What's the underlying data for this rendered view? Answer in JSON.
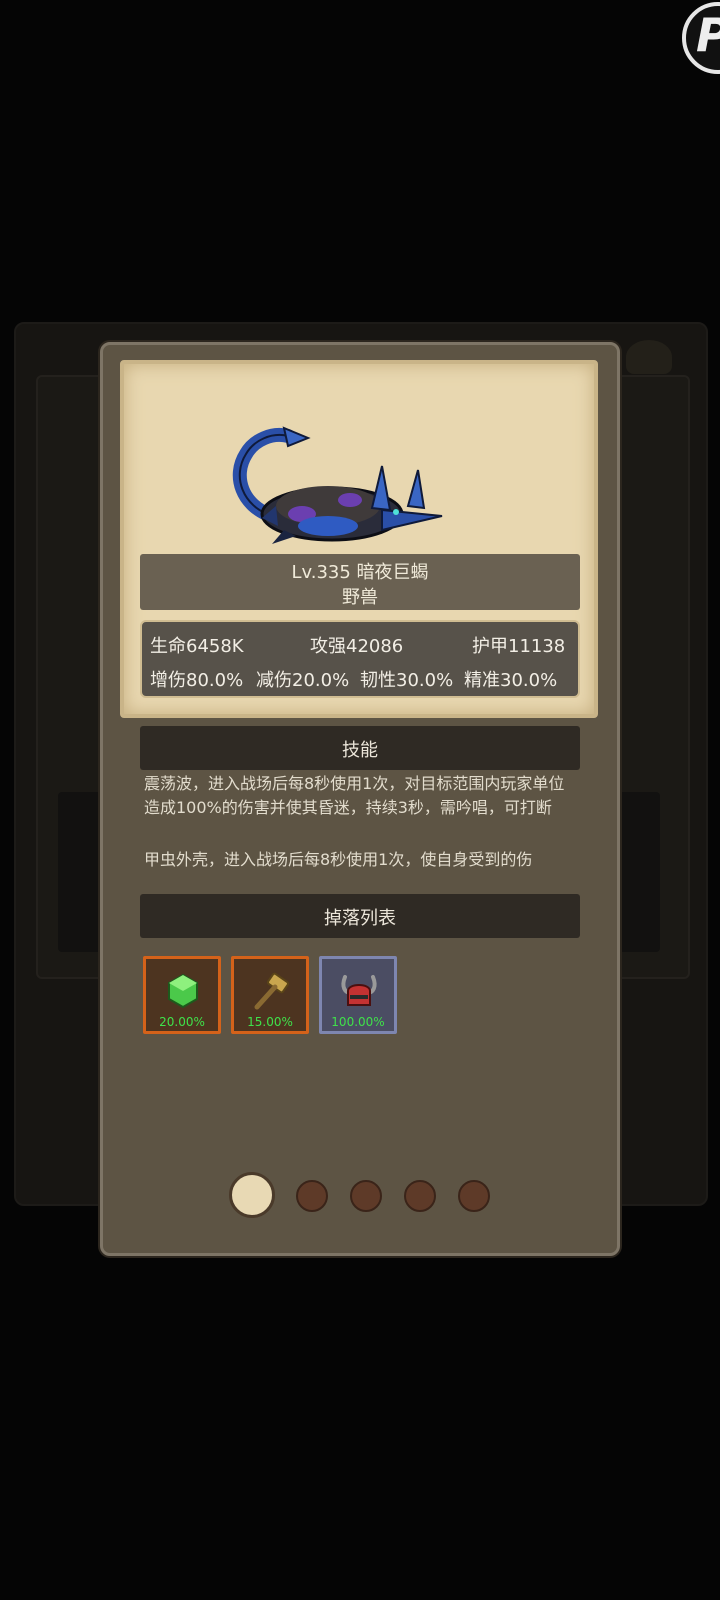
{
  "monster": {
    "level_name": "Lv.335 暗夜巨蝎",
    "type": "野兽",
    "icon": "scorpion-monster-icon"
  },
  "stats": {
    "hp": "生命6458K",
    "attack": "攻强42086",
    "armor": "护甲11138",
    "dmg_up": "增伤80.0%",
    "dmg_down": "减伤20.0%",
    "toughness": "韧性30.0%",
    "accuracy": "精准30.0%"
  },
  "skills": {
    "title": "技能",
    "items": [
      {
        "text": "震荡波，进入战场后每8秒使用1次，对目标范围内玩家单位造成100%的伤害并使其昏迷，持续3秒，需吟唱，可打断"
      },
      {
        "text": "甲虫外壳，进入战场后每8秒使用1次，使自身受到的伤"
      }
    ]
  },
  "drops": {
    "title": "掉落列表",
    "items": [
      {
        "icon": "green-gem-icon",
        "rate": "20.00%",
        "frame_color": "#d4621a"
      },
      {
        "icon": "hammer-icon",
        "rate": "15.00%",
        "frame_color": "#d4621a"
      },
      {
        "icon": "horned-helmet-icon",
        "rate": "100.00%",
        "frame_color": "#7e86b0"
      }
    ]
  },
  "pager": {
    "pages": 5,
    "current": 1
  },
  "colors": {
    "rate_text": "#3fe14a",
    "parchment": "#e8d7b0"
  }
}
